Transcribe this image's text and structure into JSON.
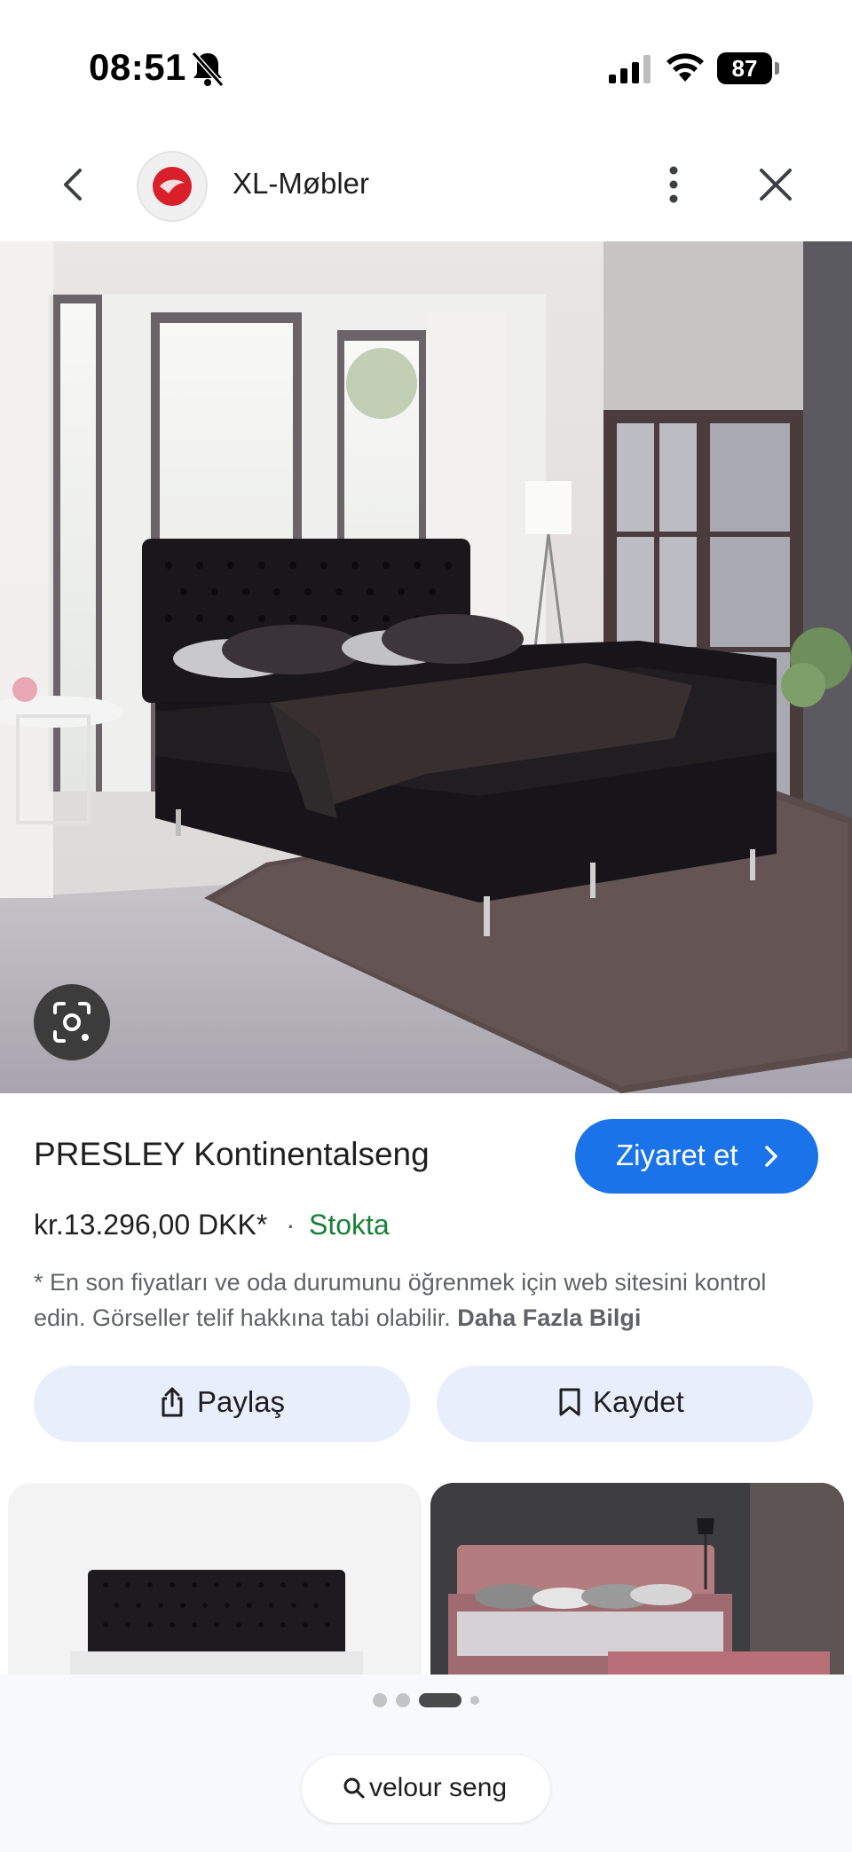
{
  "status_bar": {
    "time": "08:51",
    "battery_level": "87",
    "icons": [
      "bell-slash-icon",
      "signal-icon",
      "wifi-icon",
      "battery-icon"
    ]
  },
  "header": {
    "site_name": "XL-Møbler",
    "icons": [
      "back-chevron-icon",
      "site-logo",
      "more-vert-icon",
      "close-icon"
    ]
  },
  "product": {
    "title": "PRESLEY Kontinentalseng",
    "visit_label": "Ziyaret et",
    "price": "kr.13.296,00 DKK*",
    "separator": "·",
    "stock": "Stokta",
    "disclaimer": "* En son fiyatları ve oda durumunu öğrenmek için web sitesini kontrol edin. Görseller telif hakkına tabi olabilir.",
    "more_info": "Daha Fazla Bilgi"
  },
  "actions": {
    "share_label": "Paylaş",
    "save_label": "Kaydet"
  },
  "pager": {
    "count": 4,
    "active_index": 2
  },
  "search_chip": {
    "query": "velour seng"
  },
  "colors": {
    "accent": "#1a73e8",
    "stock_green": "#188038",
    "pill_bg": "#e8eefc",
    "text_secondary": "#5f6368"
  }
}
